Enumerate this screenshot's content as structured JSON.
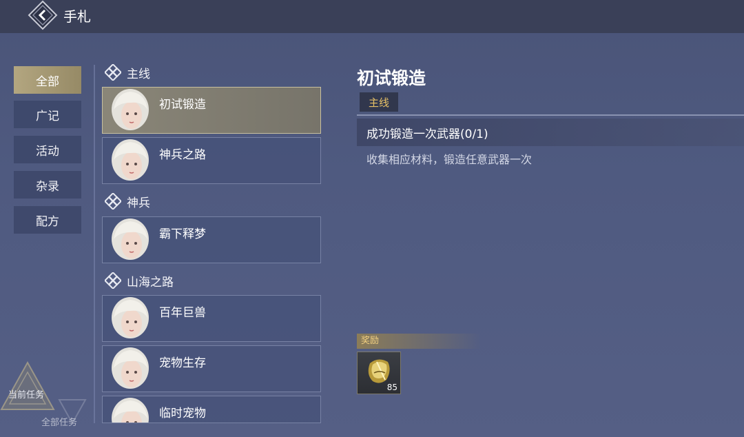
{
  "header": {
    "title": "手札"
  },
  "categories": [
    {
      "label": "全部",
      "active": true
    },
    {
      "label": "广记",
      "active": false
    },
    {
      "label": "活动",
      "active": false
    },
    {
      "label": "杂录",
      "active": false
    },
    {
      "label": "配方",
      "active": false
    }
  ],
  "sections": [
    {
      "title": "主线",
      "quests": [
        "初试锻造",
        "神兵之路"
      ]
    },
    {
      "title": "神兵",
      "quests": [
        "霸下释梦"
      ]
    },
    {
      "title": "山海之路",
      "quests": [
        "百年巨兽",
        "宠物生存",
        "临时宠物"
      ]
    }
  ],
  "detail": {
    "title": "初试锻造",
    "tag": "主线",
    "objective": "成功锻造一次武器(0/1)",
    "description": "收集相应材料，锻造任意武器一次",
    "reward_label": "奖励",
    "reward_count": "85"
  },
  "bottom": {
    "current_task": "当前任务",
    "all_task": "全部任务"
  },
  "colors": {
    "accent_gold": "#e6c066",
    "active_tab": "#b3a680",
    "background": "#4f5a80"
  }
}
